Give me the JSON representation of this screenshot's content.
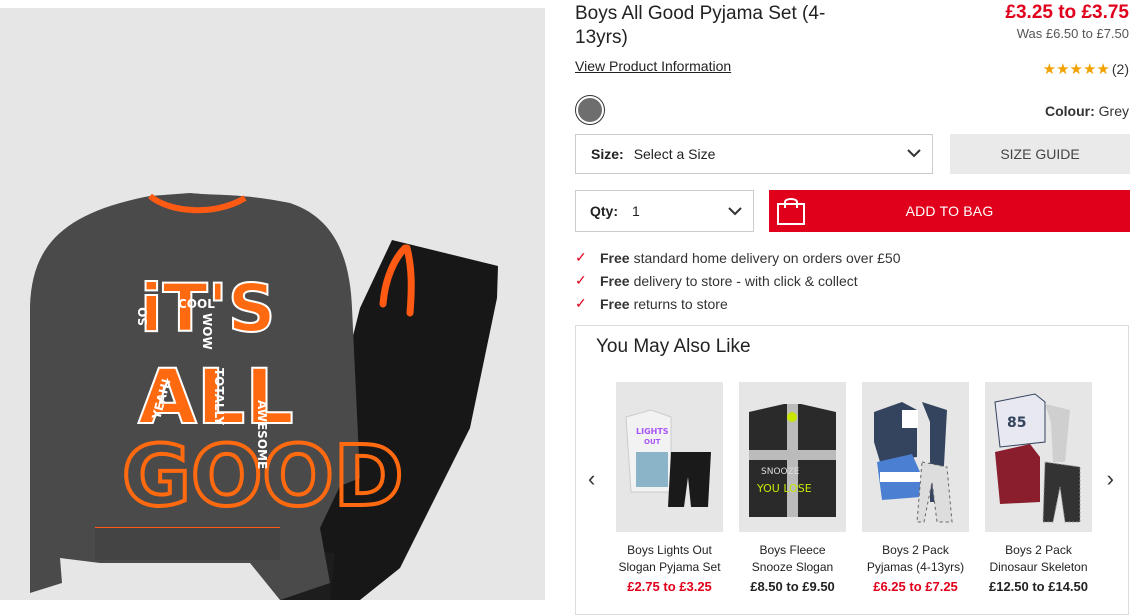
{
  "product": {
    "title": "Boys All Good Pyjama Set (4-13yrs)",
    "price": "£3.25 to £3.75",
    "was_price": "Was £6.50 to £7.50",
    "view_info": "View Product Information",
    "rating_stars": "★★★★★",
    "rating_count": "(2)",
    "colour_label": "Colour:",
    "colour_value": "Grey",
    "swatch_color": "#6e6e6e",
    "accent_color": "#e0001b"
  },
  "artwork": {
    "line1": "iT'S",
    "line2": "ALL",
    "line3": "GOOD",
    "small1": "SO",
    "small2": "COOL",
    "small3": "WOW",
    "small4": "TOTALLY",
    "small5": "AWESOME",
    "small6": "YEAH!"
  },
  "size": {
    "label": "Size:",
    "value": "Select a Size",
    "guide": "SIZE GUIDE"
  },
  "qty": {
    "label": "Qty:",
    "value": "1"
  },
  "add_to_bag": "ADD TO BAG",
  "benefits": [
    {
      "bold": "Free",
      "text": "standard home delivery on orders over £50"
    },
    {
      "bold": "Free",
      "text": "delivery to store - with click & collect"
    },
    {
      "bold": "Free",
      "text": "returns to store"
    }
  ],
  "ymal": {
    "title": "You May Also Like",
    "items": [
      {
        "name": "Boys Lights Out Slogan Pyjama Set",
        "price": "£2.75 to £3.25",
        "price_color": "#e0001b",
        "art1": "LIGHTS",
        "art2": "OUT"
      },
      {
        "name": "Boys Fleece Snooze Slogan",
        "price": "£8.50 to £9.50",
        "price_color": "#222222",
        "art1": "SNOOZE",
        "art2": "YOU LOSE"
      },
      {
        "name": "Boys 2 Pack Pyjamas (4-13yrs)",
        "price": "£6.25 to £7.25",
        "price_color": "#e0001b"
      },
      {
        "name": "Boys 2 Pack Dinosaur Skeleton",
        "price": "£12.50 to £14.50",
        "price_color": "#222222",
        "art1": "85"
      }
    ]
  },
  "icons": [
    "chevron-down-icon",
    "shopping-bag-icon",
    "check-icon",
    "chevron-left-icon",
    "chevron-right-icon",
    "star-icon"
  ]
}
